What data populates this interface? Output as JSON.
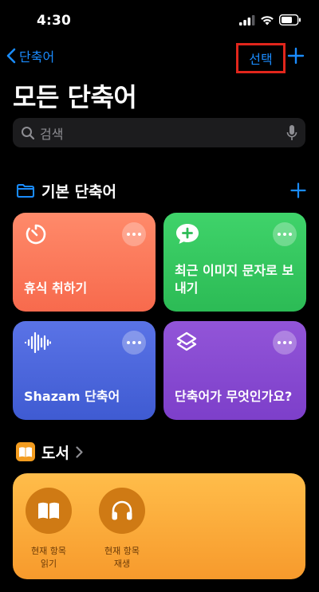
{
  "status_bar": {
    "time": "4:30"
  },
  "nav": {
    "back_label": "단축어",
    "select_label": "선택"
  },
  "page_title": "모든 단축어",
  "search": {
    "placeholder": "검색"
  },
  "section": {
    "title": "기본 단축어"
  },
  "tiles": [
    {
      "label": "휴식 취하기",
      "icon": "timer-icon",
      "color": "#f76a4d"
    },
    {
      "label": "최근 이미지 문자로 보내기",
      "icon": "message-plus-icon",
      "color": "#2cbb55"
    },
    {
      "label": "Shazam 단축어",
      "icon": "waveform-icon",
      "color": "#3f5bd2"
    },
    {
      "label": "단축어가 무엇인가요?",
      "icon": "shortcuts-layers-icon",
      "color": "#7d3fca"
    }
  ],
  "books": {
    "title": "도서",
    "actions": [
      {
        "label": "현재 항목\n읽기",
        "icon": "open-book-icon"
      },
      {
        "label": "현재 항목\n재생",
        "icon": "headphones-icon"
      }
    ]
  },
  "colors": {
    "accent": "#1a8cff",
    "highlight_border": "#e1261c",
    "background": "#000000"
  }
}
